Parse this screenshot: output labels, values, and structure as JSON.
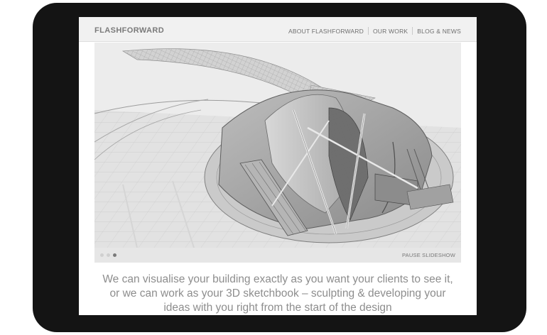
{
  "site": {
    "logo": "FLASHFORWARD"
  },
  "nav": {
    "items": [
      {
        "label": "ABOUT FLASHFORWARD"
      },
      {
        "label": "OUR WORK"
      },
      {
        "label": "BLOG & NEWS"
      }
    ]
  },
  "slideshow": {
    "slide_count": 3,
    "active_slide": 3,
    "pause_label": "PAUSE SLIDESHOW"
  },
  "intro": {
    "text": "We can visualise your building exactly as you want your clients to see it, or we can work as your 3D sketchbook – sculpting & developing your ideas with you right from the start of the design"
  },
  "colors": {
    "device_frame": "#141414",
    "header_bg": "#f1f1f1",
    "text_gray": "#8d8d8d"
  }
}
